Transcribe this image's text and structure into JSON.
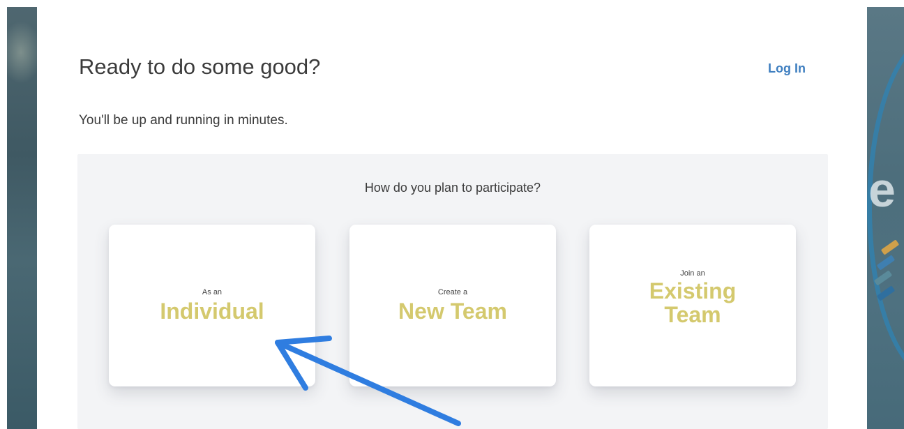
{
  "header": {
    "title": "Ready to do some good?",
    "login_label": "Log In"
  },
  "intro": {
    "subtitle": "You'll be up and running in minutes."
  },
  "participation": {
    "question": "How do you plan to participate?",
    "options": [
      {
        "prefix": "As an",
        "label": "Individual"
      },
      {
        "prefix": "Create a",
        "label": "New Team"
      },
      {
        "prefix": "Join an",
        "label_line1": "Existing",
        "label_line2": "Team"
      }
    ]
  },
  "background": {
    "right_letter": "e"
  },
  "colors": {
    "accent_link": "#3f7fc0",
    "option_label": "#d4c96e",
    "annotation_arrow": "#2f7de0",
    "choice_area_bg": "#f3f4f6"
  },
  "annotation": {
    "icon": "arrow-pointer-icon",
    "points_to": "Individual"
  }
}
